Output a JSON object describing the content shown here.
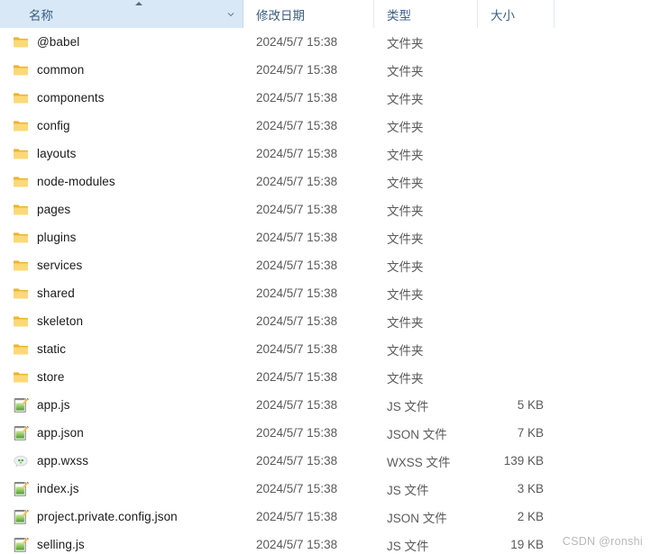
{
  "columns": {
    "name": {
      "label": "名称",
      "sort": "ascending",
      "sort_icon": "caret-up-icon",
      "menu_icon": "chevron-down-icon"
    },
    "date": {
      "label": "修改日期"
    },
    "type": {
      "label": "类型"
    },
    "size": {
      "label": "大小"
    }
  },
  "rows": [
    {
      "icon": "folder-icon",
      "name": "@babel",
      "date": "2024/5/7 15:38",
      "type": "文件夹",
      "size": ""
    },
    {
      "icon": "folder-icon",
      "name": "common",
      "date": "2024/5/7 15:38",
      "type": "文件夹",
      "size": ""
    },
    {
      "icon": "folder-icon",
      "name": "components",
      "date": "2024/5/7 15:38",
      "type": "文件夹",
      "size": ""
    },
    {
      "icon": "folder-icon",
      "name": "config",
      "date": "2024/5/7 15:38",
      "type": "文件夹",
      "size": ""
    },
    {
      "icon": "folder-icon",
      "name": "layouts",
      "date": "2024/5/7 15:38",
      "type": "文件夹",
      "size": ""
    },
    {
      "icon": "folder-icon",
      "name": "node-modules",
      "date": "2024/5/7 15:38",
      "type": "文件夹",
      "size": ""
    },
    {
      "icon": "folder-icon",
      "name": "pages",
      "date": "2024/5/7 15:38",
      "type": "文件夹",
      "size": ""
    },
    {
      "icon": "folder-icon",
      "name": "plugins",
      "date": "2024/5/7 15:38",
      "type": "文件夹",
      "size": ""
    },
    {
      "icon": "folder-icon",
      "name": "services",
      "date": "2024/5/7 15:38",
      "type": "文件夹",
      "size": ""
    },
    {
      "icon": "folder-icon",
      "name": "shared",
      "date": "2024/5/7 15:38",
      "type": "文件夹",
      "size": ""
    },
    {
      "icon": "folder-icon",
      "name": "skeleton",
      "date": "2024/5/7 15:38",
      "type": "文件夹",
      "size": ""
    },
    {
      "icon": "folder-icon",
      "name": "static",
      "date": "2024/5/7 15:38",
      "type": "文件夹",
      "size": ""
    },
    {
      "icon": "folder-icon",
      "name": "store",
      "date": "2024/5/7 15:38",
      "type": "文件夹",
      "size": ""
    },
    {
      "icon": "notepad-icon",
      "name": "app.js",
      "date": "2024/5/7 15:38",
      "type": "JS 文件",
      "size": "5 KB"
    },
    {
      "icon": "notepad-icon",
      "name": "app.json",
      "date": "2024/5/7 15:38",
      "type": "JSON 文件",
      "size": "7 KB"
    },
    {
      "icon": "wxss-icon",
      "name": "app.wxss",
      "date": "2024/5/7 15:38",
      "type": "WXSS 文件",
      "size": "139 KB"
    },
    {
      "icon": "notepad-icon",
      "name": "index.js",
      "date": "2024/5/7 15:38",
      "type": "JS 文件",
      "size": "3 KB"
    },
    {
      "icon": "notepad-icon",
      "name": "project.private.config.json",
      "date": "2024/5/7 15:38",
      "type": "JSON 文件",
      "size": "2 KB"
    },
    {
      "icon": "notepad-icon",
      "name": "selling.js",
      "date": "2024/5/7 15:38",
      "type": "JS 文件",
      "size": "19 KB"
    }
  ],
  "watermark": "CSDN @ronshi",
  "colors": {
    "header_bg_active": "#d9e8f7",
    "header_text": "#3c5e80",
    "row_text": "#1b1b1b",
    "meta_text": "#5a5a5a",
    "folder_icon": "#fcd978",
    "folder_icon_dark": "#f0b429",
    "watermark": "#b9b9b9"
  }
}
